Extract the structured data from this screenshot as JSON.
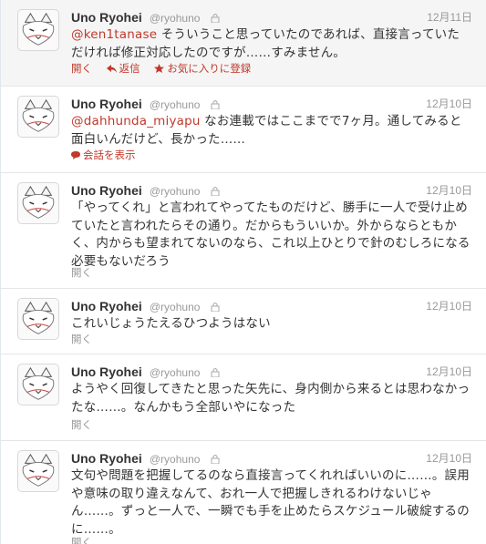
{
  "tweets": [
    {
      "name": "Uno Ryohei",
      "handle": "@ryohuno",
      "date": "12月11日",
      "mention": "@ken1tanase",
      "text": " そういうこと思っていたのであれば、直接言っていただければ修正対応したのですが……すみません。",
      "actions": {
        "open": "開く",
        "reply": "返信",
        "favorite": "お気に入りに登録"
      }
    },
    {
      "name": "Uno Ryohei",
      "handle": "@ryohuno",
      "date": "12月10日",
      "mention": "@dahhunda_miyapu",
      "text": " なお連載ではここまでで7ヶ月。通してみると面白いんだけど、長かった……",
      "actions": {
        "conversation": "会話を表示"
      }
    },
    {
      "name": "Uno Ryohei",
      "handle": "@ryohuno",
      "date": "12月10日",
      "mention": "",
      "text": "「やってくれ」と言われてやってたものだけど、勝手に一人で受け止めていたと言われたらその通り。だからもういいか。外からならともかく、内からも望まれてないのなら、これ以上ひとりで針のむしろになる必要もないだろう",
      "actions": {
        "open": "開く"
      }
    },
    {
      "name": "Uno Ryohei",
      "handle": "@ryohuno",
      "date": "12月10日",
      "mention": "",
      "text": "これいじょうたえるひつようはない",
      "actions": {
        "open": "開く"
      }
    },
    {
      "name": "Uno Ryohei",
      "handle": "@ryohuno",
      "date": "12月10日",
      "mention": "",
      "text": "ようやく回復してきたと思った矢先に、身内側から来るとは思わなかったな……。なんかもう全部いやになった",
      "actions": {
        "open": "開く"
      }
    },
    {
      "name": "Uno Ryohei",
      "handle": "@ryohuno",
      "date": "12月10日",
      "mention": "",
      "text": "文句や問題を把握してるのなら直接言ってくれればいいのに……。誤用や意味の取り違えなんて、おれ一人で把握しきれるわけないじゃん……。ずっと一人で、一瞬でも手を止めたらスケジュール破綻するのに……。",
      "actions": {
        "open": "開く"
      }
    }
  ],
  "colors": {
    "link": "#c0392b",
    "muted": "#999999",
    "highlight_bg": "#f5f5f5"
  },
  "icons": {
    "avatar": "fox-avatar-icon",
    "lock": "lock-icon",
    "reply": "reply-arrow-icon",
    "favorite": "star-icon",
    "conversation": "speech-bubble-icon"
  }
}
